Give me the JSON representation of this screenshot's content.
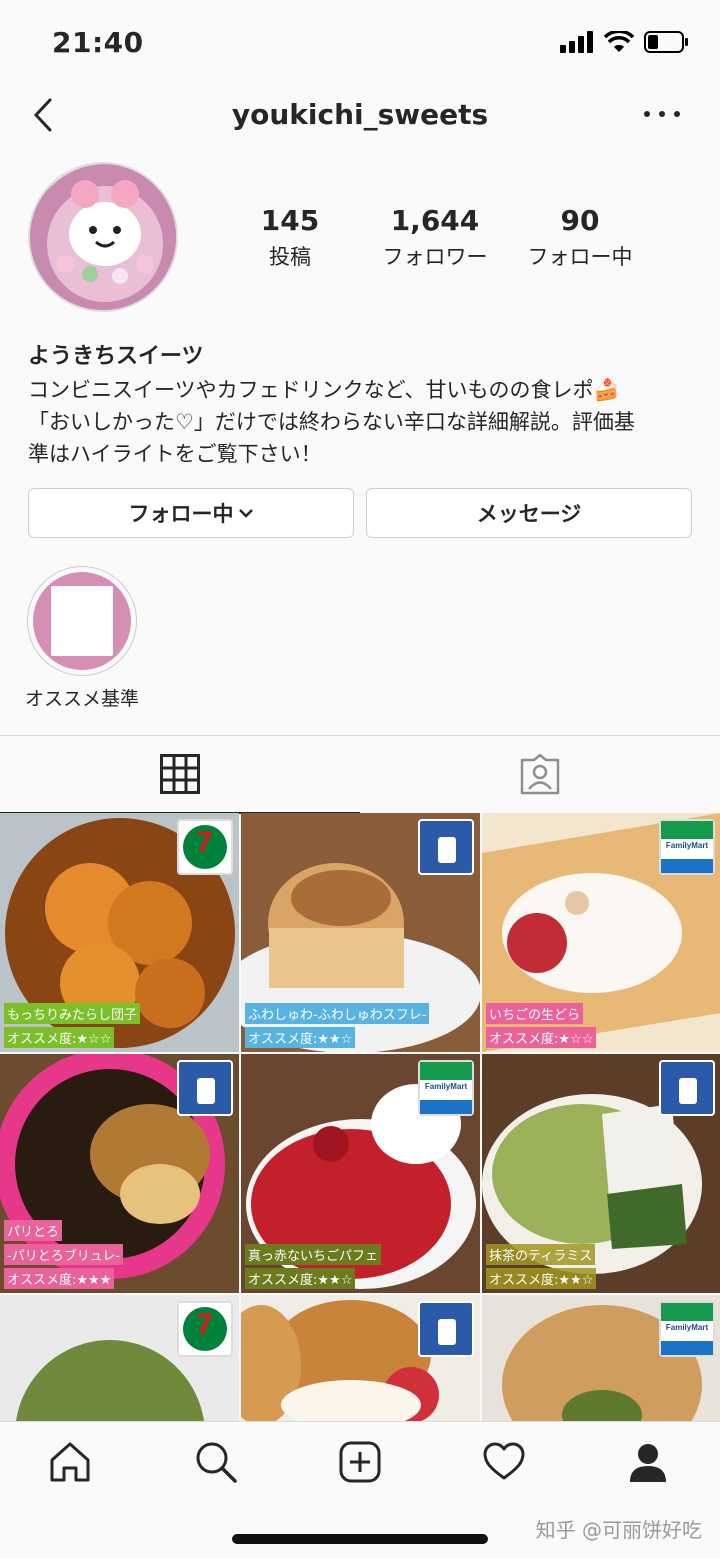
{
  "status": {
    "time": "21:40"
  },
  "nav": {
    "title": "youkichi_sweets"
  },
  "stats": [
    {
      "value": "145",
      "label": "投稿"
    },
    {
      "value": "1,644",
      "label": "フォロワー"
    },
    {
      "value": "90",
      "label": "フォロー中"
    }
  ],
  "bio": {
    "name": "ようきちスイーツ",
    "line1": "コンビニスイーツやカフェドリンクなど、甘いものの食レポ🍰",
    "line2": "「おいしかった♡」だけでは終わらない辛口な詳細解説。評価基",
    "line3": "準はハイライトをご覧下さい！"
  },
  "buttons": {
    "follow": "フォロー中",
    "message": "メッセージ"
  },
  "highlight": {
    "label": "オススメ基準"
  },
  "posts": [
    {
      "tag1": "もっちりみたらし団子",
      "tag2": "オススメ度:★☆☆",
      "store": "7eleven",
      "bg": "#a0521e"
    },
    {
      "tag1": "ふわしゅわ-ふわしゅわスフレ-",
      "tag2": "オススメ度:★★☆",
      "store": "lawson",
      "bg": "#d9a566"
    },
    {
      "tag1": "いちごの生どら",
      "tag2": "オススメ度:★☆☆",
      "store": "familymart",
      "bg": "#e7d4b6"
    },
    {
      "tag1": "パリとろ",
      "tag1b": "-パリとろブリュレ-",
      "tag2": "オススメ度:★★★",
      "store": "lawson",
      "bg": "#5a3718"
    },
    {
      "tag1": "真っ赤ないちごパフェ",
      "tag2": "オススメ度:★★☆",
      "store": "familymart",
      "bg": "#c2202a"
    },
    {
      "tag1": "抹茶のティラミス",
      "tag2": "オススメ度:★★☆",
      "store": "lawson",
      "bg": "#8aa44a"
    },
    {
      "store": "7eleven",
      "bg": "#6f8a3c"
    },
    {
      "store": "lawson",
      "bg": "#c8843a"
    },
    {
      "store": "familymart",
      "bg": "#cf9e5e"
    }
  ],
  "familymart_text": "FamilyMart",
  "watermark": "知乎 @可丽饼好吃"
}
